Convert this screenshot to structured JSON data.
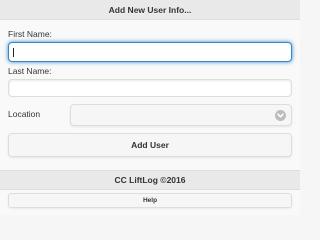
{
  "header": {
    "title": "Add New User Info..."
  },
  "form": {
    "first_name": {
      "label": "First Name:",
      "value": "",
      "placeholder": ""
    },
    "last_name": {
      "label": "Last Name:",
      "value": "",
      "placeholder": ""
    },
    "location": {
      "label": "Location",
      "selected": ""
    },
    "submit_label": "Add User"
  },
  "footer": {
    "text": "CC LiftLog ©2016"
  },
  "help": {
    "label": "Help"
  },
  "icons": {
    "select_indicator": "chevron-down-icon"
  },
  "colors": {
    "focus_accent": "#3388cc",
    "bar_background": "#e9e9e9"
  }
}
